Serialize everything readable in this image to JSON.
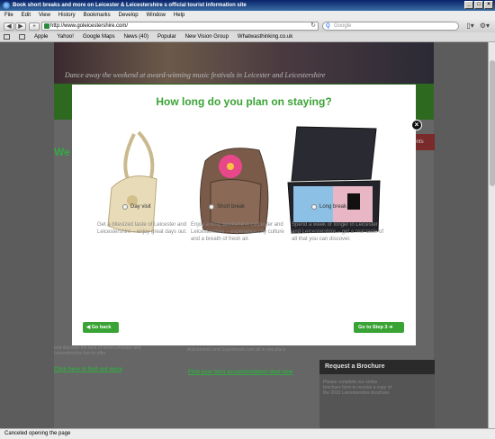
{
  "window": {
    "title": "Book short breaks and more on Leicester & Leicestershire s official tourist information site"
  },
  "menu": [
    "File",
    "Edit",
    "View",
    "History",
    "Bookmarks",
    "Develop",
    "Window",
    "Help"
  ],
  "toolbar": {
    "url": "http://www.goleicestershire.com/",
    "search_placeholder": "Google"
  },
  "bookmarks": [
    "Apple",
    "Yahoo!",
    "Google Maps",
    "News (40)",
    "Popular",
    "New Vision Group",
    "Whatwasthinking.co.uk"
  ],
  "status": "Canceled opening the page",
  "background_page": {
    "hero_caption": "Dance away the weekend at award-winning music festivals in Leicester and Leicestershire",
    "heading": "We & L",
    "side_tab": "ents",
    "find_out_more": "Click here to find out more",
    "accommodation_link": "Find your best accommodation deal now",
    "brochure_title": "Request a Brochure",
    "brochure_text": "Please complete our online brochure form to receive a copy of the 2010 Leicestershire brochure.",
    "partners_text": "more deals from Laterooms.com, Venere.com, Activehotels and Superbreak.com all in one place",
    "leicester_text": "and discover the best of what Leicester and Leicestershire has to offer"
  },
  "modal": {
    "title": "How long do you plan on staying?",
    "options": [
      {
        "label": "Day visit",
        "description": "Get a bitesized taste of Leicester and Leicestershire – enjoy great days out."
      },
      {
        "label": "Short break",
        "description": "Enjoy a long weekend in Leicester and Leicestershire – experience city culture and a breath of fresh air."
      },
      {
        "label": "Long break",
        "description": "Spend a week or longer in Leicester and Leicestershire – get a real taste of all that you can discover."
      }
    ],
    "back_label": "Go back",
    "next_label": "Go to Step 3"
  },
  "colors": {
    "accent": "#3aa335"
  }
}
